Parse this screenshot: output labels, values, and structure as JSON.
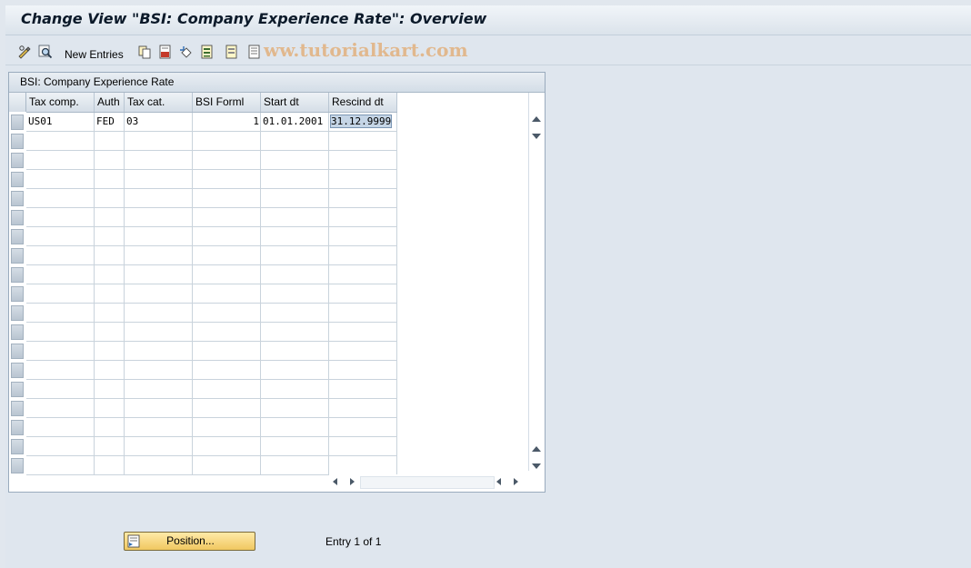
{
  "window": {
    "title": "Change View \"BSI: Company Experience Rate\": Overview"
  },
  "toolbar": {
    "new_entries_label": "New Entries",
    "icons": [
      "display-change-icon",
      "find-icon",
      "copy-icon",
      "save-icon",
      "undo-icon",
      "select-all-icon",
      "deselect-all-icon",
      "select-block-icon"
    ]
  },
  "watermark": "ww.tutorialkart.com",
  "table": {
    "title": "BSI: Company Experience Rate",
    "columns": [
      "Tax comp.",
      "Auth",
      "Tax cat.",
      "BSI Forml",
      "Start dt",
      "Rescind dt"
    ],
    "rows": [
      [
        "US01",
        "FED",
        "03",
        "1",
        "01.01.2001",
        "31.12.9999"
      ]
    ],
    "empty_rows": 18
  },
  "footer": {
    "position_button_label": "Position...",
    "entry_info": "Entry 1 of 1"
  },
  "colors": {
    "background": "#dfe6ee",
    "button_accent": "#f0c760",
    "selection": "#c5d5e6"
  }
}
